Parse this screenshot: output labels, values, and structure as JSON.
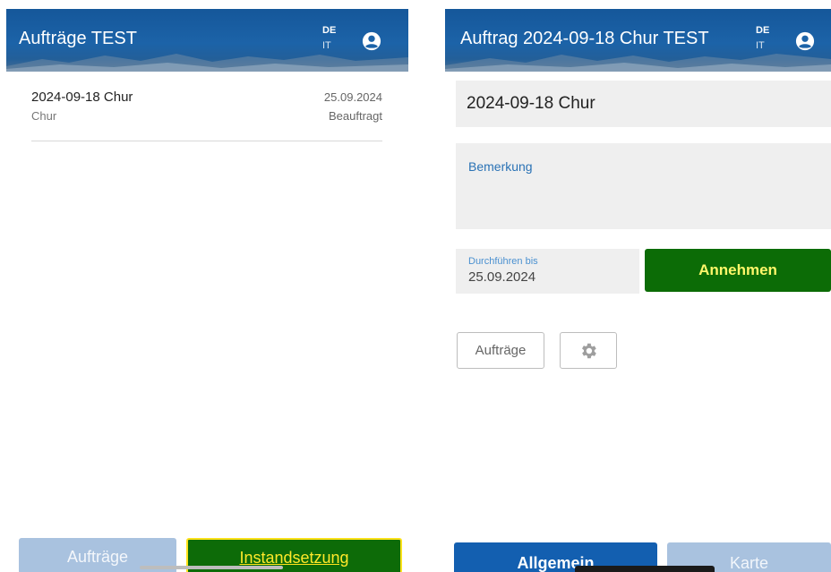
{
  "left": {
    "appbar": {
      "title": "Aufträge TEST",
      "lang_de": "DE",
      "lang_it": "IT"
    },
    "list": [
      {
        "title": "2024-09-18 Chur",
        "subtitle": "Chur",
        "date": "25.09.2024",
        "status": "Beauftragt"
      }
    ],
    "buttons": {
      "auftraege": "Aufträge",
      "instandsetzung": "Instandsetzung"
    }
  },
  "right": {
    "appbar": {
      "title": "Auftrag 2024-09-18 Chur TEST",
      "lang_de": "DE",
      "lang_it": "IT"
    },
    "name_value": "2024-09-18 Chur",
    "bemerkung_label": "Bemerkung",
    "durchfuehren_label": "Durchführen bis",
    "durchfuehren_value": "25.09.2024",
    "annehmen": "Annehmen",
    "auftraege": "Aufträge",
    "tabs": {
      "allgemein": "Allgemein",
      "karte": "Karte"
    }
  },
  "colors": {
    "appbar_blue": "#1c63a8",
    "primary_green": "#0c6c06",
    "accent_yellow": "#ffe92a",
    "disabled_blue": "#a9c2df",
    "primary_blue": "#135fb0"
  },
  "icons": {
    "account": "account-circle-icon",
    "settings": "gear-icon"
  }
}
